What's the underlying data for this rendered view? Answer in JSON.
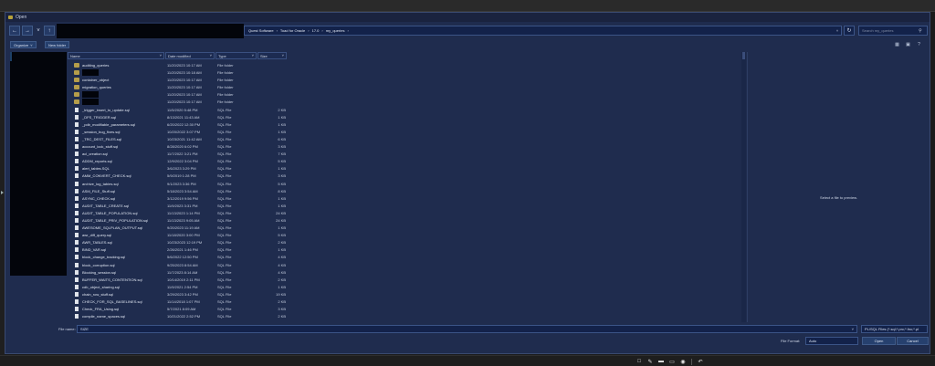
{
  "window": {
    "title": "Open"
  },
  "address": {
    "crumbs": [
      "Quest Software",
      "Toad for Oracle",
      "17.0",
      "my_queries"
    ]
  },
  "search": {
    "placeholder": "Search my_queries"
  },
  "toolbar": {
    "organize_label": "Organize",
    "new_folder_label": "New folder"
  },
  "columns": {
    "name": "Name",
    "date": "Date modified",
    "type": "Type",
    "size": "Size"
  },
  "files": [
    {
      "icon": "folder",
      "name": "auditing_queries",
      "date": "11/20/2023 10:17 AM",
      "type": "File folder",
      "size": ""
    },
    {
      "icon": "folder",
      "name": "",
      "date": "11/20/2023 10:18 AM",
      "type": "File folder",
      "size": "",
      "redacted": true
    },
    {
      "icon": "folder",
      "name": "container_object",
      "date": "11/20/2023 10:17 AM",
      "type": "File folder",
      "size": ""
    },
    {
      "icon": "folder",
      "name": "migration_queries",
      "date": "11/20/2023 10:17 AM",
      "type": "File folder",
      "size": ""
    },
    {
      "icon": "folder",
      "name": "",
      "date": "11/20/2023 10:17 AM",
      "type": "File folder",
      "size": "",
      "redacted": true
    },
    {
      "icon": "folder",
      "name": "",
      "date": "11/20/2023 10:17 AM",
      "type": "File folder",
      "size": "",
      "redacted": true
    },
    {
      "icon": "file",
      "name": "_trigger_insert_to_update.sql",
      "date": "11/5/2020 5:48 PM",
      "type": "SQL File",
      "size": "2 KB"
    },
    {
      "icon": "file",
      "name": "_DFS_TRIGGER.sql",
      "date": "8/13/2021 11:43 AM",
      "type": "SQL File",
      "size": "1 KB"
    },
    {
      "icon": "file",
      "name": "_pdb_modifiable_parameters.sql",
      "date": "6/20/2022 12:30 PM",
      "type": "SQL File",
      "size": "1 KB"
    },
    {
      "icon": "file",
      "name": "_session_bug_fixes.sql",
      "date": "10/20/2022 3:07 PM",
      "type": "SQL File",
      "size": "1 KB"
    },
    {
      "icon": "file",
      "name": "_TRC_DEST_FILES.sql",
      "date": "10/23/2021 11:42 AM",
      "type": "SQL File",
      "size": "6 KB"
    },
    {
      "icon": "file",
      "name": "account_lock_stuff.sql",
      "date": "8/28/2020 6:02 PM",
      "type": "SQL File",
      "size": "3 KB"
    },
    {
      "icon": "file",
      "name": "acl_creation.sql",
      "date": "11/7/2022 3:21 PM",
      "type": "SQL File",
      "size": "7 KB"
    },
    {
      "icon": "file",
      "name": "ADDM_reports.sql",
      "date": "12/9/2022 3:04 PM",
      "type": "SQL File",
      "size": "5 KB"
    },
    {
      "icon": "file",
      "name": "alert_tables.SQL",
      "date": "3/6/2023 3:29 PM",
      "type": "SQL File",
      "size": "1 KB"
    },
    {
      "icon": "file",
      "name": "AMM_CONVERT_CHECK.sql",
      "date": "5/9/2019 1:28 PM",
      "type": "SQL File",
      "size": "3 KB"
    },
    {
      "icon": "file",
      "name": "archive_log_tables.sql",
      "date": "9/1/2023 3:36 PM",
      "type": "SQL File",
      "size": "5 KB"
    },
    {
      "icon": "file",
      "name": "ASM_FILE_Stuff.sql",
      "date": "5/18/2023 3:54 AM",
      "type": "SQL File",
      "size": "8 KB"
    },
    {
      "icon": "file",
      "name": "ASYNC_CHECK.sql",
      "date": "3/12/2019 9:56 PM",
      "type": "SQL File",
      "size": "1 KB"
    },
    {
      "icon": "file",
      "name": "AUDIT_TABLE_CREATE.sql",
      "date": "11/9/2023 3:31 PM",
      "type": "SQL File",
      "size": "1 KB"
    },
    {
      "icon": "file",
      "name": "AUDIT_TABLE_POPULATION.sql",
      "date": "11/13/2023 1:14 PM",
      "type": "SQL File",
      "size": "24 KB"
    },
    {
      "icon": "file",
      "name": "AUDIT_TABLE_PRIV_POPULATION.sql",
      "date": "11/13/2023 9:05 AM",
      "type": "SQL File",
      "size": "24 KB"
    },
    {
      "icon": "file",
      "name": "AWESOME_SQLPLAN_OUTPUT.sql",
      "date": "9/20/2023 11:19 AM",
      "type": "SQL File",
      "size": "1 KB"
    },
    {
      "icon": "file",
      "name": "awr_diff_query.sql",
      "date": "11/18/2020 3:00 PM",
      "type": "SQL File",
      "size": "5 KB"
    },
    {
      "icon": "file",
      "name": "AWR_TABLES.sql",
      "date": "10/23/2023 12:19 PM",
      "type": "SQL File",
      "size": "2 KB"
    },
    {
      "icon": "file",
      "name": "BIND_VAR.sql",
      "date": "2/26/2021 1:46 PM",
      "type": "SQL File",
      "size": "1 KB"
    },
    {
      "icon": "file",
      "name": "block_change_tracking.sql",
      "date": "5/6/2022 12:50 PM",
      "type": "SQL File",
      "size": "4 KB"
    },
    {
      "icon": "file",
      "name": "block_corruption.sql",
      "date": "9/25/2023 8:54 AM",
      "type": "SQL File",
      "size": "4 KB"
    },
    {
      "icon": "file",
      "name": "Blocking_session.sql",
      "date": "11/7/2023 8:14 AM",
      "type": "SQL File",
      "size": "4 KB"
    },
    {
      "icon": "file",
      "name": "BUFFER_WAITS_CONTENTION.sql",
      "date": "10/14/2019 2:11 PM",
      "type": "SQL File",
      "size": "2 KB"
    },
    {
      "icon": "file",
      "name": "cdb_object_sharing.sql",
      "date": "11/9/2021 2:54 PM",
      "type": "SQL File",
      "size": "1 KB"
    },
    {
      "icon": "file",
      "name": "chain_row_stuff.sql",
      "date": "3/29/2023 3:42 PM",
      "type": "SQL File",
      "size": "19 KB"
    },
    {
      "icon": "file",
      "name": "CHECK_FOR_SQL_BASELINES.sql",
      "date": "11/14/2018 1:07 PM",
      "type": "SQL File",
      "size": "2 KB"
    },
    {
      "icon": "file",
      "name": "Check_FRA_Using.sql",
      "date": "5/7/2021 8:09 AM",
      "type": "SQL File",
      "size": "3 KB"
    },
    {
      "icon": "file",
      "name": "compile_name_spaces.sql",
      "date": "10/21/2022 2:52 PM",
      "type": "SQL File",
      "size": "2 KB"
    }
  ],
  "preview": {
    "text": "Select a file to preview."
  },
  "file_name": {
    "label": "File name:",
    "value": "SIZE"
  },
  "filter": {
    "value": "PL/SQL Files (*.sql;*.prc;*.fnc;*.pl"
  },
  "file_format": {
    "label": "File Format:",
    "value": "Auto"
  },
  "buttons": {
    "open": "Open",
    "cancel": "Cancel"
  },
  "icons": {
    "back": "back-arrow-icon",
    "forward": "forward-arrow-icon",
    "recent": "chevron-down-icon",
    "up": "up-arrow-icon",
    "refresh": "refresh-icon",
    "search": "search-icon",
    "view": "view-options-icon",
    "preview_pane": "preview-pane-icon",
    "help": "help-icon"
  },
  "colors": {
    "dialog_bg": "#1f2c4e",
    "folder": "#b59d4a",
    "accent_border": "#3b5487"
  }
}
